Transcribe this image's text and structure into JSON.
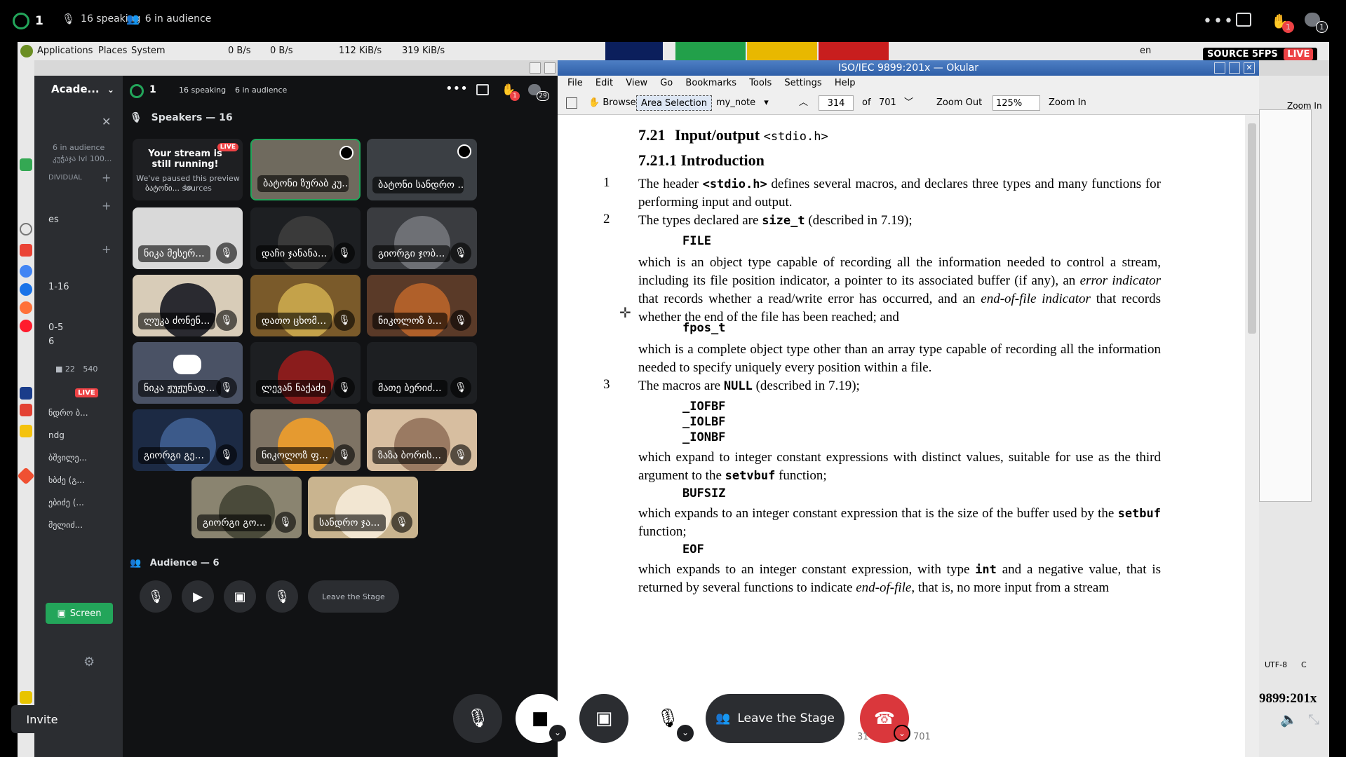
{
  "outer_bar": {
    "listener_count": "1",
    "speaking": "16 speaking",
    "audience": "6 in audience",
    "raise_hand_badge": "1",
    "notif_badge": "1"
  },
  "stream_badge": {
    "source": "SOURCE 5FPS",
    "live": "LIVE"
  },
  "gnome": {
    "menus": [
      "Applications",
      "Places",
      "System"
    ],
    "net1": "0 B/s",
    "net2": "0 B/s",
    "net3": "112 KiB/s",
    "net4": "319 KiB/s",
    "lang": "en"
  },
  "inner_discord": {
    "server_name": "Acade...",
    "listener_count": "1",
    "speaking": "16 speaking",
    "audience": "6 in audience",
    "raise_badge": "1",
    "notif_badge": "29",
    "speakers_header": "Speakers — 16",
    "audience_header": "Audience — 6",
    "sidebar_texts": [
      "6 in audience",
      "კუჭაჯა lvl 100...",
      "DIVIDUAL",
      "es",
      "1-16",
      "0-5",
      "6",
      "22",
      "540",
      "LIVE",
      "ნდრო ბ...",
      "ndg",
      "ბშვილე...",
      "ხბძე (გ...",
      "ებიძე (...",
      "მელიძ..."
    ],
    "screen_button": "Screen",
    "invite": "Invite",
    "leave_stage": "Leave the Stage",
    "stream_notice_title": "Your stream is still running!",
    "stream_notice_body": "We've paused this preview to",
    "stream_notice_name": "ბატონი...",
    "stream_notice_tail": "sources",
    "live": "LIVE",
    "tiles": [
      {
        "name": "ბატონი ზურაბ კუ...",
        "color": "#6f6a5e"
      },
      {
        "name": "ბატონი სანდრო ...",
        "color": "#3b3f44"
      },
      {
        "name": "ნიკა მესერ...",
        "color": "#d9d9d9"
      },
      {
        "name": "დაჩი ჯანანა...",
        "color": "#1d1f22"
      },
      {
        "name": "გიორგი ჯობ...",
        "color": "#3a3c40"
      },
      {
        "name": "ლუკა ძონენ...",
        "color": "#d8ccb8"
      },
      {
        "name": "დათო ცხომ...",
        "color": "#7a5a2a"
      },
      {
        "name": "ნიკოლოზ ბ...",
        "color": "#5a3a28"
      },
      {
        "name": "ნიკა ჟუჟუნად...",
        "color": "#4a5265"
      },
      {
        "name": "ლევან ნაქაძე",
        "color": "#1d1f22"
      },
      {
        "name": "მათე ბერიძ...",
        "color": "#1d1f22"
      },
      {
        "name": "გიორგი გე...",
        "color": "#1c2a44"
      },
      {
        "name": "ნიკოლოზ ფ...",
        "color": "#7e7364"
      },
      {
        "name": "ზაზა ბორის...",
        "color": "#d7bea0"
      },
      {
        "name": "გიორგი გო...",
        "color": "#8a8470"
      },
      {
        "name": "სანდრო ჯა...",
        "color": "#c9b48f"
      }
    ]
  },
  "okular": {
    "title": "ISO/IEC 9899:201x — Okular",
    "menus": [
      "File",
      "Edit",
      "View",
      "Go",
      "Bookmarks",
      "Tools",
      "Settings",
      "Help"
    ],
    "browse": "Browse",
    "area_selection": "Area Selection",
    "note": "my_note",
    "page_number": "314",
    "of_label": "of",
    "page_total": "701",
    "zoom_out": "Zoom Out",
    "zoom_value": "125%",
    "zoom_in": "Zoom In",
    "doc": {
      "h1_num": "7.21",
      "h1_text": "Input/output",
      "h1_code": "<stdio.h>",
      "h2": "7.21.1  Introduction",
      "p1_num": "1",
      "p1_a": "The header ",
      "p1_code": "<stdio.h>",
      "p1_b": " defines several macros, and declares three types and many functions for performing input and output.",
      "p2_num": "2",
      "p2_a": "The types declared are ",
      "p2_code": "size_t",
      "p2_b": " (described in 7.19);",
      "file": "FILE",
      "p3_a": "which is an object type capable of recording all the information needed to control a stream, including its file position indicator, a pointer to its associated buffer (if any), an ",
      "p3_i1": "error indicator",
      "p3_b": " that records whether a read/write error has occurred, and an ",
      "p3_i2": "end-of-file indicator",
      "p3_c": " that records whether the end of the file has been reached; and",
      "fpos": "fpos_t",
      "p4": "which is a complete object type other than an array type capable of recording all the information needed to specify uniquely every position within a file.",
      "p5_num": "3",
      "p5_a": "The macros are ",
      "p5_code": "NULL",
      "p5_b": " (described in 7.19);",
      "iofbf": "_IOFBF",
      "iolbf": "_IOLBF",
      "ionbf": "_IONBF",
      "p6_a": "which expand to integer constant expressions with distinct values, suitable for use as the third argument to the ",
      "p6_code": "setvbuf",
      "p6_b": " function;",
      "bufsiz": "BUFSIZ",
      "p7_a": "which expands to an integer constant expression that is the size of the buffer used by the ",
      "p7_code": "setbuf",
      "p7_b": " function;",
      "eof": "EOF",
      "p8_a": "which expands to an integer constant expression, with type ",
      "p8_code": "int",
      "p8_b": " and a negative value, that is returned by several functions to indicate ",
      "p8_i": "end-of-file",
      "p8_c": ", that is, no more input from a stream"
    }
  },
  "win3": {
    "zoom_in": "Zoom In",
    "encoding": "UTF-8",
    "col": "C",
    "doc_tail": "9899:201x"
  },
  "bottom_bar": {
    "leave_stage": "Leave the Stage",
    "page_hint_a": "31",
    "page_hint_b": "701"
  },
  "colors": {
    "accent_green": "#23a55a",
    "danger_red": "#da373c",
    "live_red": "#ed4245"
  }
}
